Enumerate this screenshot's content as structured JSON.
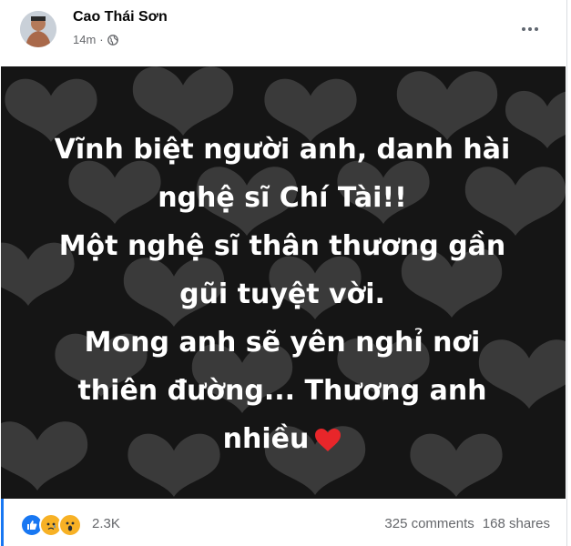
{
  "post": {
    "author": "Cao Thái Sơn",
    "time": "14m",
    "separator": "·",
    "privacy_icon": "globe-icon",
    "more_icon": "more-options-icon",
    "text_lines": [
      "Vĩnh biệt người anh, danh hài",
      "nghệ sĩ Chí Tài!!",
      "Một nghệ sĩ thân thương gần",
      "gũi tuyệt vời.",
      "Mong anh sẽ yên nghỉ nơi",
      "thiên đường... Thương anh",
      "nhiều"
    ],
    "background": "dark-hearts",
    "emoji": "red-heart-icon"
  },
  "footer": {
    "reactions": [
      "like-reaction-icon",
      "sad-reaction-icon",
      "wow-reaction-icon"
    ],
    "reaction_count": "2.3K",
    "comments": "325 comments",
    "shares": "168 shares"
  },
  "colors": {
    "background": "#151515",
    "heart_fill": "#3a3a3a",
    "accent": "#1877f2",
    "red_heart": "#e8262a"
  }
}
